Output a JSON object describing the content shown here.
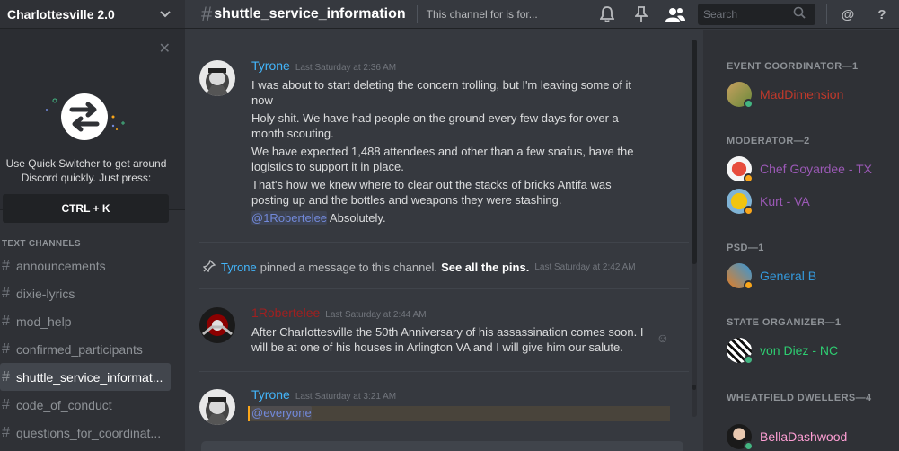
{
  "server": {
    "name": "Charlottesville 2.0"
  },
  "quick_switcher": {
    "text": "Use Quick Switcher to get around Discord quickly. Just press:",
    "shortcut": "CTRL + K"
  },
  "channels": {
    "heading": "TEXT CHANNELS",
    "items": [
      {
        "name": "announcements",
        "active": false
      },
      {
        "name": "dixie-lyrics",
        "active": false
      },
      {
        "name": "mod_help",
        "active": false
      },
      {
        "name": "confirmed_participants",
        "active": false
      },
      {
        "name": "shuttle_service_informat...",
        "active": true
      },
      {
        "name": "code_of_conduct",
        "active": false
      },
      {
        "name": "questions_for_coordinat...",
        "active": false
      }
    ]
  },
  "header": {
    "channel_name": "shuttle_service_information",
    "topic": "This channel for is for...",
    "search_placeholder": "Search"
  },
  "messages": [
    {
      "author": "Tyrone",
      "timestamp": "Last Saturday at 2:36 AM",
      "lines": [
        "I was about to start deleting the concern trolling, but I'm leaving some of it now",
        "Holy shit. We have had people on the ground every few days for over a month scouting.",
        "We have expected 1,488 attendees and other than a few snafus, have the logistics to support it in place.",
        "That's how we knew where to clear out the stacks of bricks Antifa was posting up and the bottles and weapons they were stashing."
      ],
      "mention": "@1Robertelee",
      "mention_suffix": " Absolutely."
    },
    {
      "author": "1Robertelee",
      "timestamp": "Last Saturday at 2:44 AM",
      "lines": [
        "After Charlottesville the 50th Anniversary of his assassination comes soon. I will be at one of his houses in Arlington VA and I will give him our salute."
      ]
    },
    {
      "author": "Tyrone",
      "timestamp": "Last Saturday at 3:21 AM",
      "mention": "@everyone"
    }
  ],
  "pin_notice": {
    "author": "Tyrone",
    "text": "pinned a message to this channel.",
    "link": "See all the pins.",
    "timestamp": "Last Saturday at 2:42 AM"
  },
  "members": [
    {
      "role": "EVENT COORDINATOR—1",
      "people": [
        {
          "name": "MadDimension",
          "color": "#c0392b"
        }
      ]
    },
    {
      "role": "MODERATOR—2",
      "people": [
        {
          "name": "Chef Goyardee - TX",
          "color": "#9b59b6"
        },
        {
          "name": "Kurt - VA",
          "color": "#9b59b6"
        }
      ]
    },
    {
      "role": "PSD—1",
      "people": [
        {
          "name": "General B",
          "color": "#3498db"
        }
      ]
    },
    {
      "role": "STATE ORGANIZER—1",
      "people": [
        {
          "name": "von Diez - NC",
          "color": "#2ecc71"
        }
      ]
    },
    {
      "role": "WHEATFIELD DWELLERS—4",
      "people": [
        {
          "name": "BellaDashwood",
          "color": "#ff9fd5"
        }
      ]
    }
  ]
}
